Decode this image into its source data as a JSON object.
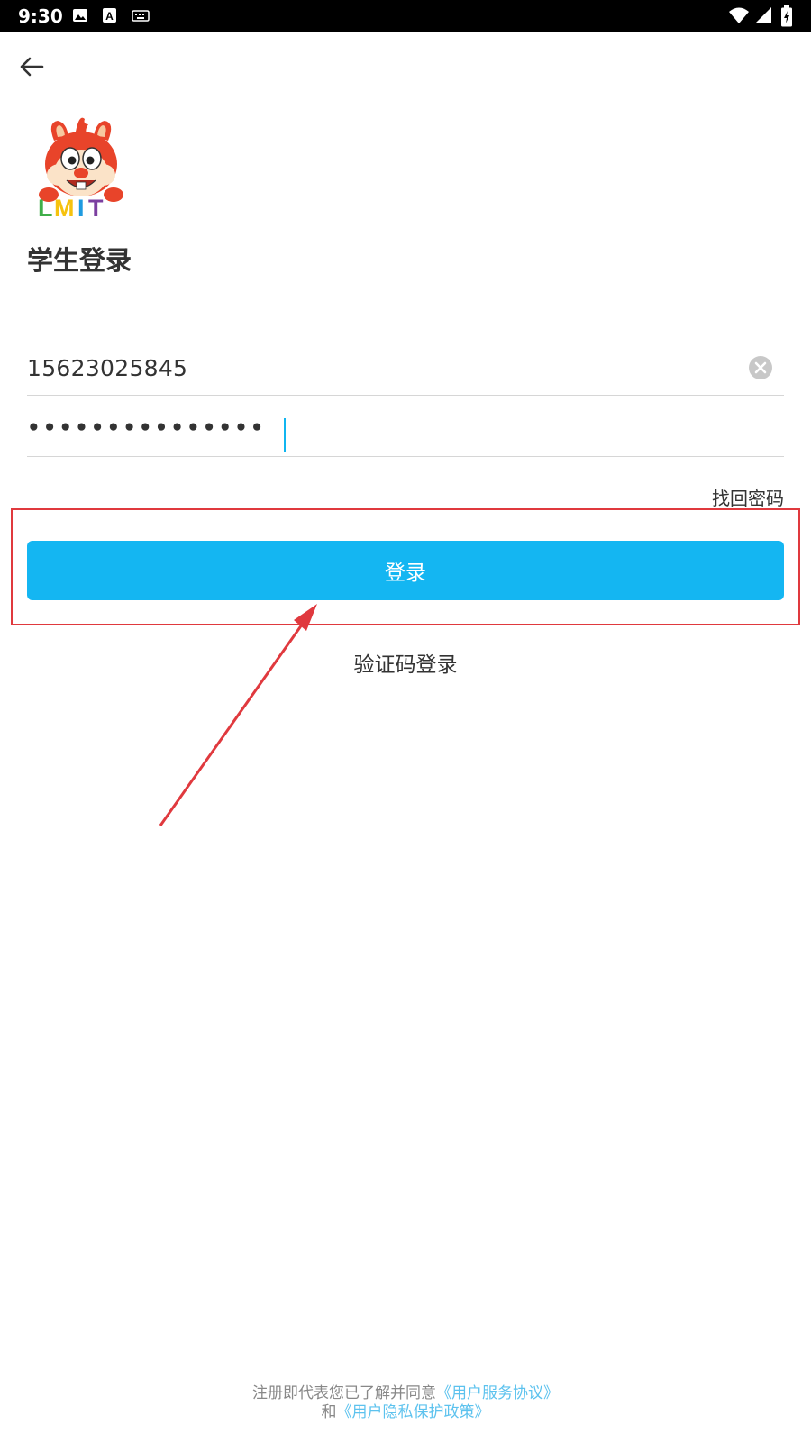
{
  "status_bar": {
    "time": "9:30",
    "icons": [
      "image-icon",
      "a-icon",
      "keyboard-icon",
      "wifi-icon",
      "signal-icon",
      "battery-icon"
    ]
  },
  "header": {
    "back_icon": "back-arrow-icon",
    "logo_text": "LMIT",
    "title": "学生登录"
  },
  "form": {
    "phone_value": "15623025845",
    "password_mask": "•••••••••••••••",
    "clear_icon": "clear-icon",
    "forgot_label": "找回密码",
    "login_label": "登录",
    "sms_login_label": "验证码登录"
  },
  "footer": {
    "line1_text": "注册即代表您已了解并同意",
    "terms_link": "《用户服务协议》",
    "line2_text": "和",
    "privacy_link": "《用户隐私保护政策》"
  },
  "colors": {
    "accent": "#14b6f2",
    "annotation": "#e0393e",
    "link": "#5cc2ee"
  }
}
